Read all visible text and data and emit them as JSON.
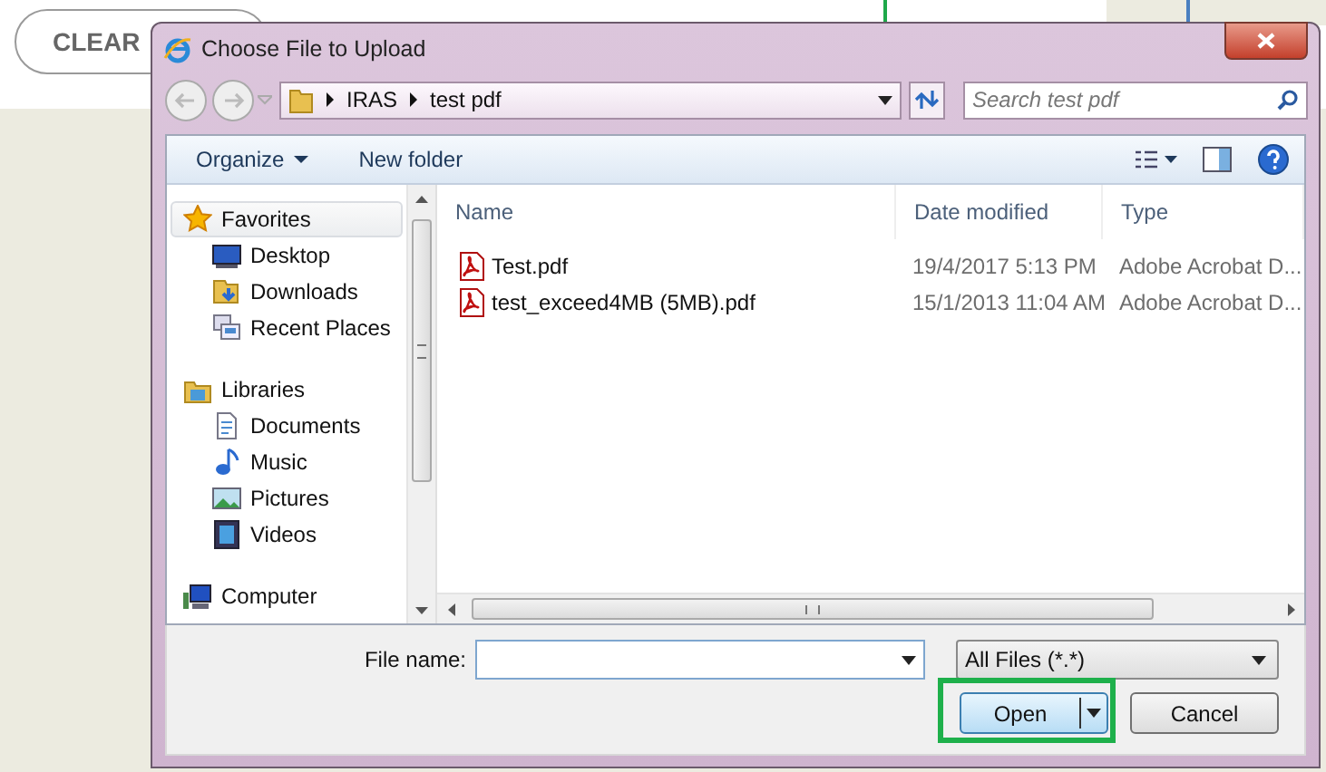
{
  "background_page": {
    "clear_button": "CLEAR"
  },
  "window": {
    "title": "Choose File to Upload"
  },
  "address_bar": {
    "path": [
      "IRAS",
      "test pdf"
    ]
  },
  "search": {
    "placeholder": "Search test pdf"
  },
  "toolbar": {
    "items": [
      {
        "label": "Organize",
        "menu": true
      },
      {
        "label": "New folder",
        "menu": false
      }
    ]
  },
  "nav": {
    "sections": [
      {
        "label": "Favorites",
        "selected": true,
        "children": [
          {
            "label": "Desktop",
            "selected": false
          },
          {
            "label": "Downloads",
            "selected": false
          },
          {
            "label": "Recent Places",
            "selected": false
          }
        ]
      },
      {
        "label": "Libraries",
        "selected": false,
        "children": [
          {
            "label": "Documents",
            "selected": false
          },
          {
            "label": "Music",
            "selected": false
          },
          {
            "label": "Pictures",
            "selected": false
          },
          {
            "label": "Videos",
            "selected": false
          }
        ]
      },
      {
        "label": "Computer",
        "selected": false
      }
    ]
  },
  "table": {
    "columns": [
      "Name",
      "Date modified",
      "Type"
    ],
    "rows": [
      {
        "name": "Test.pdf",
        "date": "19/4/2017 5:13 PM",
        "type": "Adobe Acrobat D..."
      },
      {
        "name": "test_exceed4MB (5MB).pdf",
        "date": "15/1/2013 11:04 AM",
        "type": "Adobe Acrobat D..."
      }
    ]
  },
  "file_name": {
    "label": "File name:"
  },
  "file_type": {
    "value": "All Files (*.*)"
  },
  "buttons": [
    {
      "label": "Open",
      "kind": "split",
      "highlighted": true
    },
    {
      "label": "Cancel",
      "kind": "plain",
      "highlighted": false
    }
  ]
}
